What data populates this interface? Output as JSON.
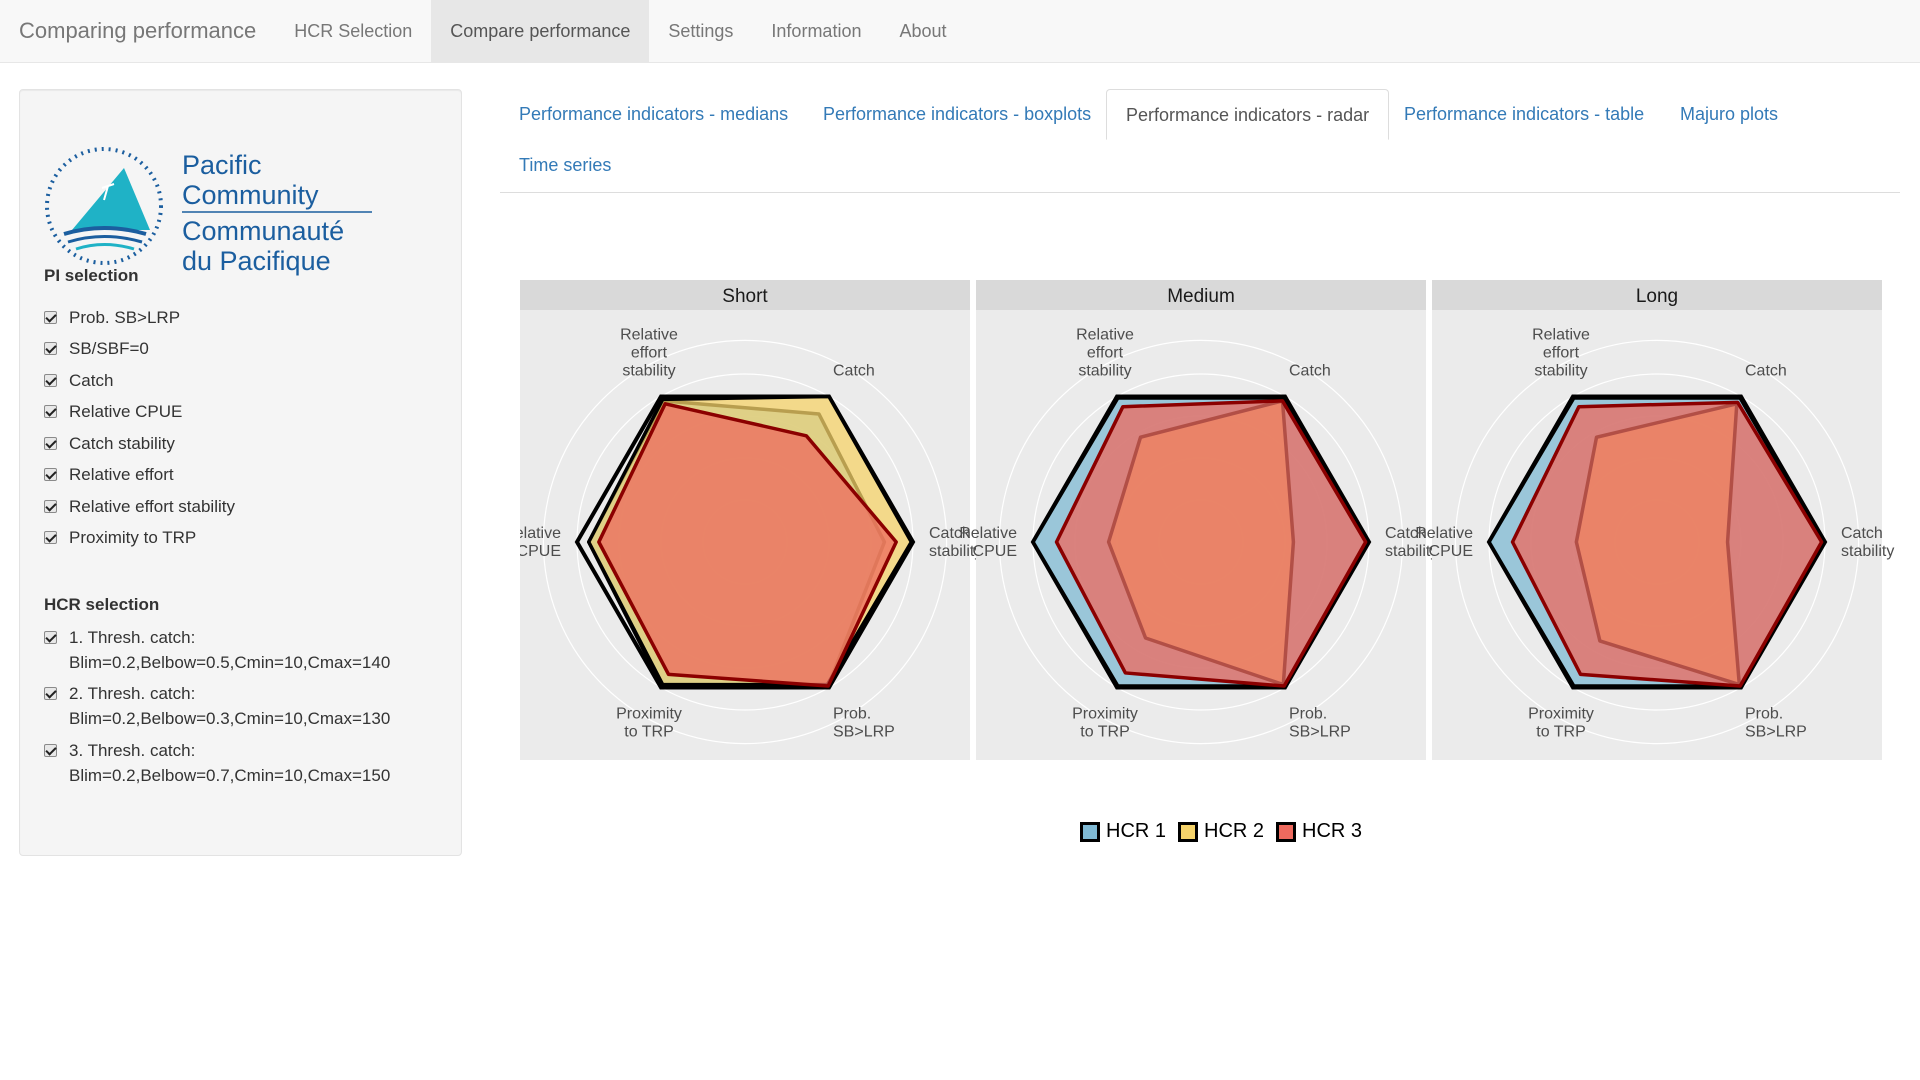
{
  "navbar": {
    "brand": "Comparing performance",
    "items": [
      "HCR Selection",
      "Compare performance",
      "Settings",
      "Information",
      "About"
    ],
    "active_index": 1
  },
  "sidebar": {
    "logo": {
      "line1": "Pacific",
      "line2": "Community",
      "line3": "Communauté",
      "line4": "du Pacifique",
      "color": "#1b5e9f",
      "teal": "#1fb2c6"
    },
    "pi_title": "PI selection",
    "pi_items": [
      "Prob. SB>LRP",
      "SB/SBF=0",
      "Catch",
      "Relative CPUE",
      "Catch stability",
      "Relative effort",
      "Relative effort stability",
      "Proximity to TRP"
    ],
    "hcr_title": "HCR selection",
    "hcr_items": [
      {
        "line1": "1. Thresh. catch:",
        "line2": "Blim=0.2,Belbow=0.5,Cmin=10,Cmax=140"
      },
      {
        "line1": "2. Thresh. catch:",
        "line2": "Blim=0.2,Belbow=0.3,Cmin=10,Cmax=130"
      },
      {
        "line1": "3. Thresh. catch:",
        "line2": "Blim=0.2,Belbow=0.7,Cmin=10,Cmax=150"
      }
    ]
  },
  "tabs": {
    "items": [
      "Performance indicators - medians",
      "Performance indicators - boxplots",
      "Performance indicators - radar",
      "Performance indicators - table",
      "Majuro plots",
      "Time series"
    ],
    "active_index": 2
  },
  "chart_data": {
    "type": "radar",
    "panels": [
      "Short",
      "Medium",
      "Long"
    ],
    "axes": [
      "Catch",
      "Catch stability",
      "Prob. SB>LRP",
      "Proximity to TRP",
      "Relative CPUE",
      "Relative effort stability"
    ],
    "axis_labels": [
      [
        "Catch"
      ],
      [
        "Catch",
        "stability"
      ],
      [
        "Prob.",
        "SB>LRP"
      ],
      [
        "Proximity",
        "to TRP"
      ],
      [
        "Relative",
        "CPUE"
      ],
      [
        "Relative",
        "effort",
        "stability"
      ]
    ],
    "rmax": 1,
    "series": [
      {
        "name": "HCR 1",
        "color": "#7fb9d3",
        "values": {
          "Short": [
            0.88,
            0.83,
            0.99,
            0.99,
            0.93,
            0.97
          ],
          "Medium": [
            0.99,
            0.99,
            0.99,
            0.99,
            1.0,
            0.99
          ],
          "Long": [
            0.99,
            0.99,
            0.99,
            0.99,
            1.0,
            0.99
          ]
        }
      },
      {
        "name": "HCR 2",
        "color": "#f5d36a",
        "values": {
          "Short": [
            1.0,
            0.99,
            0.98,
            0.98,
            0.93,
            0.98
          ],
          "Medium": [
            0.97,
            0.55,
            0.98,
            0.66,
            0.55,
            0.72
          ],
          "Long": [
            0.95,
            0.42,
            0.98,
            0.68,
            0.48,
            0.72
          ]
        }
      },
      {
        "name": "HCR 3",
        "color": "#ee6a5e",
        "values": {
          "Short": [
            0.73,
            0.9,
            0.99,
            0.91,
            0.87,
            0.95
          ],
          "Medium": [
            0.97,
            0.98,
            0.99,
            0.9,
            0.86,
            0.93
          ],
          "Long": [
            0.96,
            0.98,
            0.99,
            0.91,
            0.86,
            0.93
          ]
        }
      }
    ],
    "legend_position": "bottom"
  }
}
